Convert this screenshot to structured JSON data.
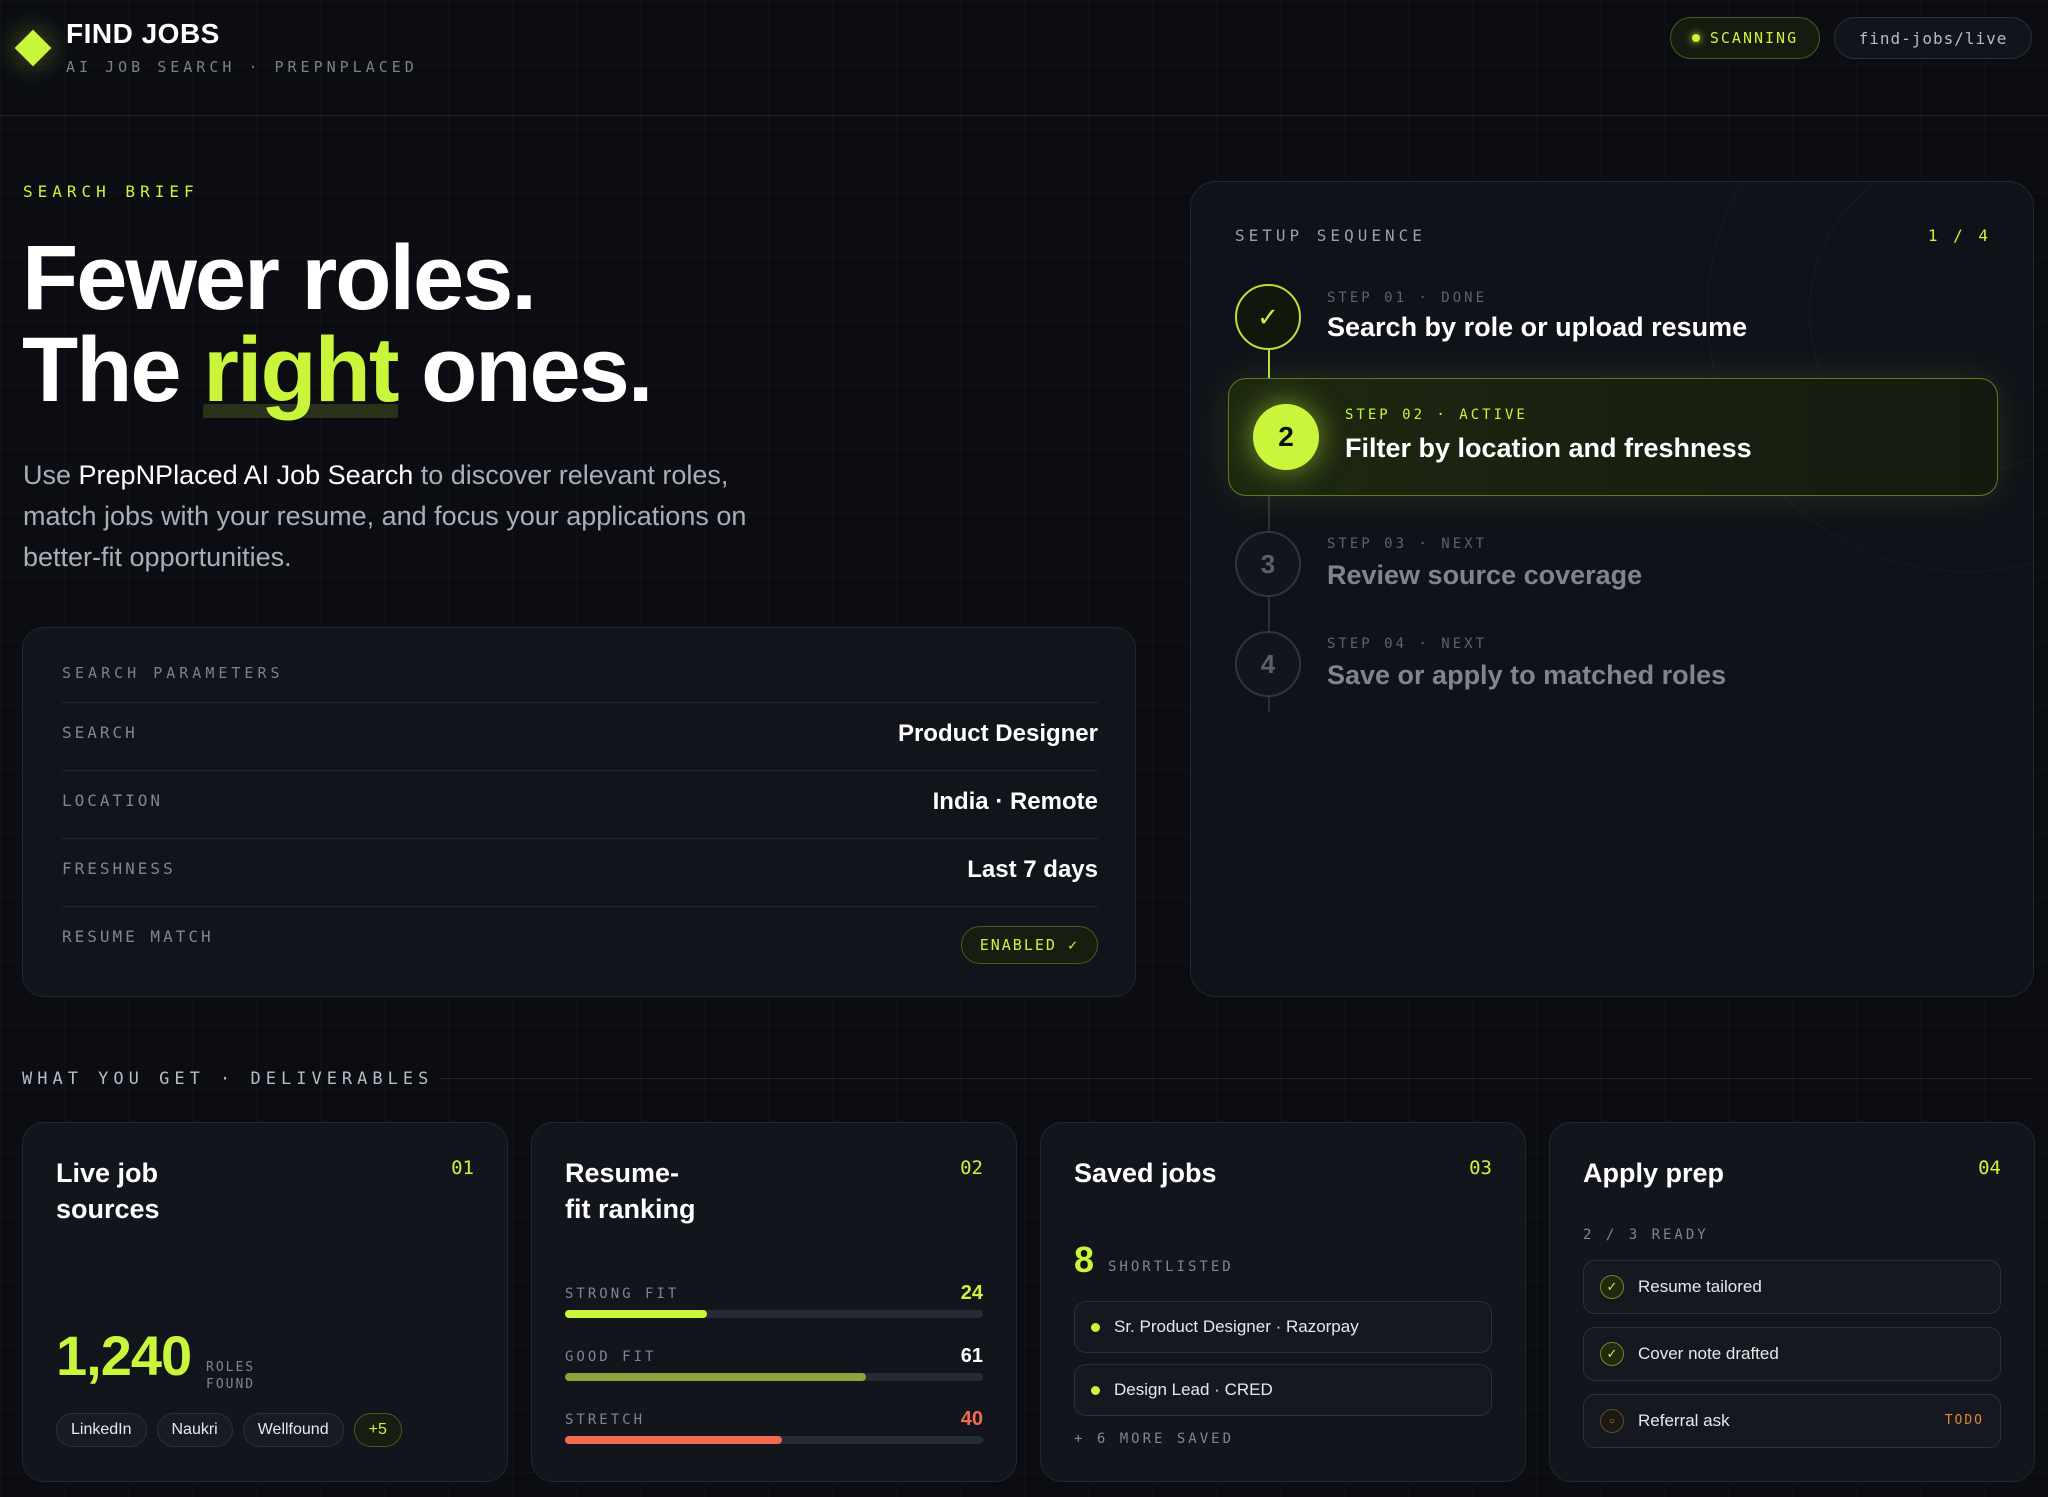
{
  "header": {
    "title": "FIND JOBS",
    "subtitle": "AI JOB SEARCH · PREPNPLACED",
    "status_label": "SCANNING",
    "route_label": "find-jobs/live"
  },
  "hero": {
    "eyebrow": "SEARCH BRIEF",
    "line1": "Fewer roles.",
    "line2_pre": "The ",
    "line2_highlight": "right",
    "line2_post": " ones.",
    "desc_pre": "Use ",
    "desc_brand": "PrepNPlaced AI Job Search",
    "desc_post": " to discover relevant roles, match jobs with your resume, and focus your applications on better-fit opportunities."
  },
  "params": {
    "title": "SEARCH PARAMETERS",
    "rows": [
      {
        "key": "SEARCH",
        "value": "Product Designer"
      },
      {
        "key": "LOCATION",
        "value": "India · Remote"
      },
      {
        "key": "FRESHNESS",
        "value": "Last 7 days"
      },
      {
        "key": "RESUME MATCH",
        "value": "ENABLED ✓"
      }
    ]
  },
  "setup": {
    "title": "SETUP SEQUENCE",
    "count": "1 / 4",
    "steps": [
      {
        "marker": "✓",
        "meta": "STEP 01 · DONE",
        "label": "Search by role or upload resume"
      },
      {
        "marker": "2",
        "meta": "STEP 02 · ACTIVE",
        "label": "Filter by location and freshness"
      },
      {
        "marker": "3",
        "meta": "STEP 03 · NEXT",
        "label": "Review source coverage"
      },
      {
        "marker": "4",
        "meta": "STEP 04 · NEXT",
        "label": "Save or apply to matched roles"
      }
    ]
  },
  "deliverables": {
    "heading": "WHAT YOU GET · DELIVERABLES",
    "cards": [
      {
        "num": "01",
        "title_l1": "Live job",
        "title_l2": "sources",
        "stat": "1,240",
        "stat_l1": "ROLES",
        "stat_l2": "FOUND",
        "chips": [
          "LinkedIn",
          "Naukri",
          "Wellfound",
          "+5"
        ]
      },
      {
        "num": "02",
        "title_l1": "Resume-",
        "title_l2": "fit ranking",
        "bars": [
          {
            "label": "STRONG FIT",
            "value": "24",
            "fill": 0.34,
            "color": "#c9f53b"
          },
          {
            "label": "GOOD FIT",
            "value": "61",
            "fill": 0.72,
            "color": "#8aa53a"
          },
          {
            "label": "STRETCH",
            "value": "40",
            "fill": 0.52,
            "color": "#f26b4f"
          }
        ]
      },
      {
        "num": "03",
        "title": "Saved jobs",
        "count": "8",
        "count_label": "SHORTLISTED",
        "items": [
          "Sr. Product Designer · Razorpay",
          "Design Lead · CRED"
        ],
        "more": "+ 6 MORE SAVED"
      },
      {
        "num": "04",
        "title": "Apply prep",
        "caption": "2 / 3 READY",
        "items": [
          {
            "label": "Resume tailored",
            "marker": "✓"
          },
          {
            "label": "Cover note drafted",
            "marker": "✓"
          },
          {
            "label": "Referral ask",
            "marker": "○",
            "tag": "TODO"
          }
        ]
      }
    ]
  },
  "colors": {
    "accent": "#c9f53b",
    "background": "#0b0d13",
    "warning": "#f26b4f",
    "todo": "#d98a3d"
  },
  "icons": [
    "logo-diamond-icon",
    "status-dot-icon",
    "check-icon",
    "pending-icon",
    "bullet-dot-icon"
  ]
}
